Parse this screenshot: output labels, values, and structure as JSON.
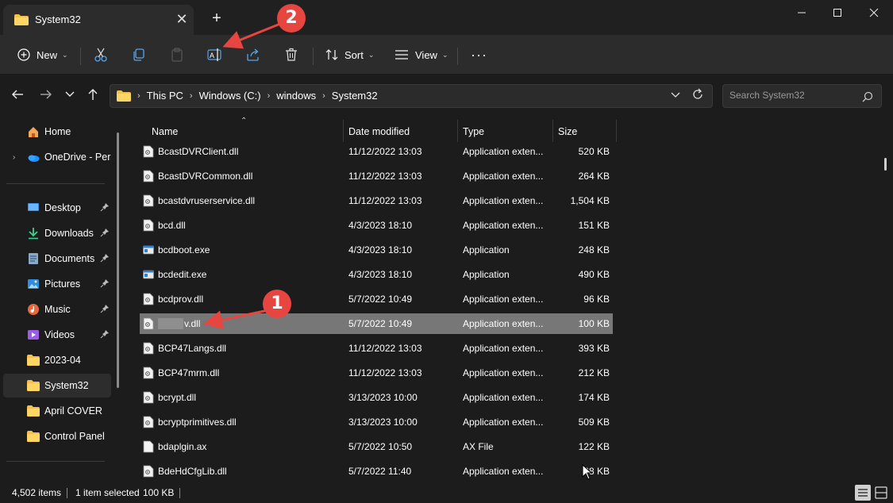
{
  "window": {
    "tab_title": "System32",
    "new_tab_symbol": "+",
    "close_symbol": "✕",
    "minimize_symbol": "—",
    "maximize_symbol": "☐"
  },
  "commandbar": {
    "new_label": "New",
    "sort_label": "Sort",
    "view_label": "View",
    "more_symbol": "···"
  },
  "address": {
    "crumbs": [
      "This PC",
      "Windows (C:)",
      "windows",
      "System32"
    ],
    "search_placeholder": "Search System32"
  },
  "sidebar": {
    "items": [
      {
        "label": "Home",
        "icon": "home-icon"
      },
      {
        "label": "OneDrive - Perso",
        "icon": "onedrive-icon"
      },
      {
        "label": "Desktop",
        "icon": "desktop-icon",
        "pinned": true
      },
      {
        "label": "Downloads",
        "icon": "downloads-icon",
        "pinned": true
      },
      {
        "label": "Documents",
        "icon": "documents-icon",
        "pinned": true
      },
      {
        "label": "Pictures",
        "icon": "pictures-icon",
        "pinned": true
      },
      {
        "label": "Music",
        "icon": "music-icon",
        "pinned": true
      },
      {
        "label": "Videos",
        "icon": "videos-icon",
        "pinned": true
      },
      {
        "label": "2023-04",
        "icon": "folder-icon"
      },
      {
        "label": "System32",
        "icon": "folder-icon",
        "selected": true
      },
      {
        "label": "April COVER",
        "icon": "folder-icon"
      },
      {
        "label": "Control Panel",
        "icon": "folder-icon"
      }
    ]
  },
  "columns": {
    "name": "Name",
    "date": "Date modified",
    "type": "Type",
    "size": "Size"
  },
  "files": [
    {
      "name": "BcastDVRClient.dll",
      "date": "11/12/2022 13:03",
      "type": "Application exten...",
      "size": "520 KB",
      "kind": "dll"
    },
    {
      "name": "BcastDVRCommon.dll",
      "date": "11/12/2022 13:03",
      "type": "Application exten...",
      "size": "264 KB",
      "kind": "dll"
    },
    {
      "name": "bcastdvruserservice.dll",
      "date": "11/12/2022 13:03",
      "type": "Application exten...",
      "size": "1,504 KB",
      "kind": "dll"
    },
    {
      "name": "bcd.dll",
      "date": "4/3/2023 18:10",
      "type": "Application exten...",
      "size": "151 KB",
      "kind": "dll"
    },
    {
      "name": "bcdboot.exe",
      "date": "4/3/2023 18:10",
      "type": "Application",
      "size": "248 KB",
      "kind": "exe"
    },
    {
      "name": "bcdedit.exe",
      "date": "4/3/2023 18:10",
      "type": "Application",
      "size": "490 KB",
      "kind": "exe"
    },
    {
      "name": "bcdprov.dll",
      "date": "5/7/2022 10:49",
      "type": "Application exten...",
      "size": "96 KB",
      "kind": "dll"
    },
    {
      "name": "v.dll",
      "date": "5/7/2022 10:49",
      "type": "Application exten...",
      "size": "100 KB",
      "kind": "dll",
      "selected": true
    },
    {
      "name": "BCP47Langs.dll",
      "date": "11/12/2022 13:03",
      "type": "Application exten...",
      "size": "393 KB",
      "kind": "dll"
    },
    {
      "name": "BCP47mrm.dll",
      "date": "11/12/2022 13:03",
      "type": "Application exten...",
      "size": "212 KB",
      "kind": "dll"
    },
    {
      "name": "bcrypt.dll",
      "date": "3/13/2023 10:00",
      "type": "Application exten...",
      "size": "174 KB",
      "kind": "dll"
    },
    {
      "name": "bcryptprimitives.dll",
      "date": "3/13/2023 10:00",
      "type": "Application exten...",
      "size": "509 KB",
      "kind": "dll"
    },
    {
      "name": "bdaplgin.ax",
      "date": "5/7/2022 10:50",
      "type": "AX File",
      "size": "122 KB",
      "kind": "file"
    },
    {
      "name": "BdeHdCfgLib.dll",
      "date": "5/7/2022 11:40",
      "type": "Application exten...",
      "size": "28 KB",
      "kind": "dll"
    }
  ],
  "status": {
    "items_count": "4,502 items",
    "selected": "1 item selected",
    "selected_size": "100 KB"
  },
  "annotations": {
    "badge_1": "1",
    "badge_2": "2",
    "color": "#e74640"
  }
}
